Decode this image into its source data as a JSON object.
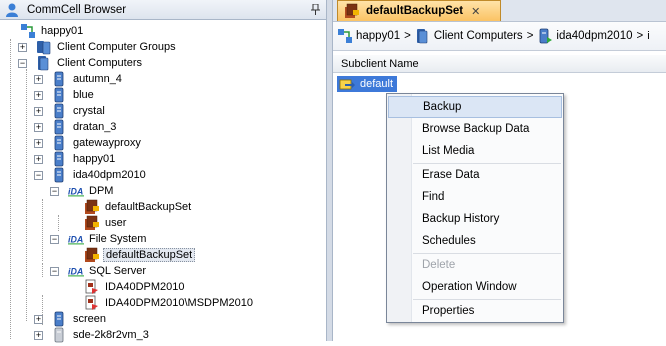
{
  "browser": {
    "title": "CommCell Browser",
    "tree": [
      {
        "label": "happy01",
        "icon": "commcell-icon",
        "indent": 0,
        "expander": "none"
      },
      {
        "label": "Client Computer Groups",
        "icon": "client-group-icon",
        "indent": 1,
        "expander": "plus"
      },
      {
        "label": "Client Computers",
        "icon": "client-computers-icon",
        "indent": 1,
        "expander": "minus"
      },
      {
        "label": "autumn_4",
        "icon": "client-icon",
        "indent": 2,
        "expander": "plus"
      },
      {
        "label": "blue",
        "icon": "client-icon",
        "indent": 2,
        "expander": "plus"
      },
      {
        "label": "crystal",
        "icon": "client-icon",
        "indent": 2,
        "expander": "plus"
      },
      {
        "label": "dratan_3",
        "icon": "client-icon",
        "indent": 2,
        "expander": "plus"
      },
      {
        "label": "gatewayproxy",
        "icon": "client-icon",
        "indent": 2,
        "expander": "plus"
      },
      {
        "label": "happy01",
        "icon": "client-icon",
        "indent": 2,
        "expander": "plus"
      },
      {
        "label": "ida40dpm2010",
        "icon": "client-icon",
        "indent": 2,
        "expander": "minus"
      },
      {
        "label": "DPM",
        "icon": "ida-icon",
        "indent": 3,
        "expander": "minus"
      },
      {
        "label": "defaultBackupSet",
        "icon": "backupset-icon",
        "indent": 4,
        "expander": "none"
      },
      {
        "label": "user",
        "icon": "backupset-icon",
        "indent": 4,
        "expander": "none"
      },
      {
        "label": "File System",
        "icon": "ida-icon",
        "indent": 3,
        "expander": "minus"
      },
      {
        "label": "defaultBackupSet",
        "icon": "backupset-icon",
        "indent": 4,
        "expander": "none",
        "selected": true
      },
      {
        "label": "SQL Server",
        "icon": "ida-icon",
        "indent": 3,
        "expander": "minus"
      },
      {
        "label": "IDA40DPM2010",
        "icon": "sql-instance-icon",
        "indent": 4,
        "expander": "none"
      },
      {
        "label": "IDA40DPM2010\\MSDPM2010",
        "icon": "sql-instance-icon",
        "indent": 4,
        "expander": "none"
      },
      {
        "label": "screen",
        "icon": "client-icon",
        "indent": 2,
        "expander": "plus"
      },
      {
        "label": "sde-2k8r2vm_3",
        "icon": "client-vm-icon",
        "indent": 2,
        "expander": "plus"
      }
    ]
  },
  "tab": {
    "title": "defaultBackupSet",
    "close": "✕"
  },
  "breadcrumb": {
    "items": [
      "happy01",
      "Client Computers",
      "ida40dpm2010",
      "i"
    ],
    "separator": ">"
  },
  "list": {
    "column": "Subclient Name",
    "rows": [
      "default"
    ]
  },
  "context_menu": {
    "items": [
      {
        "label": "Backup",
        "highlighted": true
      },
      {
        "label": "Browse Backup Data"
      },
      {
        "label": "List Media"
      },
      {
        "separator": true
      },
      {
        "label": "Erase Data"
      },
      {
        "label": "Find"
      },
      {
        "label": "Backup History"
      },
      {
        "label": "Schedules"
      },
      {
        "separator": true
      },
      {
        "label": "Delete",
        "disabled": true
      },
      {
        "label": "Operation Window"
      },
      {
        "separator": true
      },
      {
        "label": "Properties"
      }
    ]
  },
  "colors": {
    "accent": "#3d79d9",
    "tab": "#fbc364",
    "panel_border": "#a9b6c8"
  }
}
